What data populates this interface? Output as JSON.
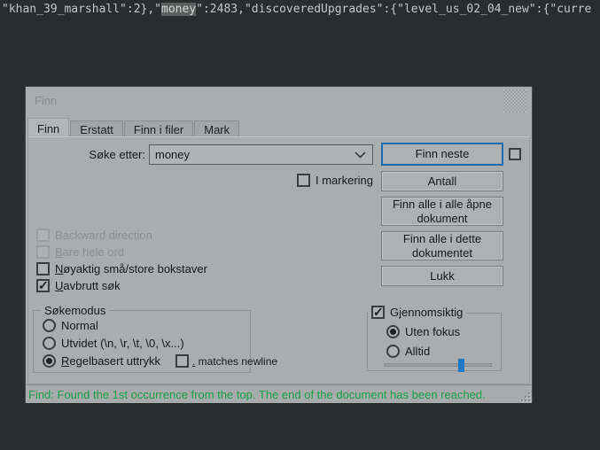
{
  "editor": {
    "line": {
      "pre": "\"khan_39_marshall\":2},\"",
      "match": "money",
      "post": "\":2483,\"discoveredUpgrades\":{\"level_us_02_04_new\":{\"curre"
    }
  },
  "dialog": {
    "title": "Finn",
    "tabs": [
      {
        "label": "Finn",
        "active": true
      },
      {
        "label": "Erstatt",
        "active": false
      },
      {
        "label": "Finn i filer",
        "active": false
      },
      {
        "label": "Mark",
        "active": false
      }
    ],
    "search_row": {
      "label": "Søke etter:",
      "value": "money"
    },
    "buttons": {
      "finn_neste": "Finn neste",
      "antall": "Antall",
      "finn_alle_apne": "Finn alle i alle åpne dokument",
      "finn_alle_dette": "Finn alle i dette dokumentet",
      "lukk": "Lukk"
    },
    "options": {
      "i_markering": {
        "label": "I markering",
        "checked": false
      },
      "backward_direction": {
        "label": "Backward direction",
        "checked": false,
        "disabled": true
      },
      "bare_hele_ord": {
        "u": "B",
        "rest": "are hele ord",
        "checked": false,
        "disabled": true
      },
      "noyaktig": {
        "u": "N",
        "rest": "øyaktig små/store bokstaver",
        "checked": false
      },
      "uavbrutt": {
        "u": "U",
        "rest": "avbrutt søk",
        "checked": true
      }
    },
    "sokemodus": {
      "title": "Søkemodus",
      "normal": {
        "label": "Normal",
        "selected": false
      },
      "utvidet": {
        "label": "Utvidet (\\n, \\r, \\t, \\0, \\x...)",
        "selected": false
      },
      "regelbasert": {
        "u": "R",
        "rest": "egelbasert uttrykk",
        "selected": true
      },
      "matches_newline": {
        "u": ".",
        "rest": " matches newline",
        "checked": false
      }
    },
    "transparency": {
      "label": "Gjennomsiktig",
      "checked": true,
      "uten_fokus": {
        "label": "Uten fokus",
        "selected": true
      },
      "alltid": {
        "label": "Alltid",
        "selected": false
      },
      "slider_percent": 69
    },
    "status": "Find: Found the 1st occurrence from the top. The end of the document has been reached."
  },
  "colors": {
    "editor_bg": "#282d2f",
    "dialog_bg": "#a9adad",
    "accent_blue": "#1a6cb1",
    "slider_blue": "#1f78c8",
    "status_green": "#17a04a",
    "match_highlight_bg": "#59605e"
  }
}
